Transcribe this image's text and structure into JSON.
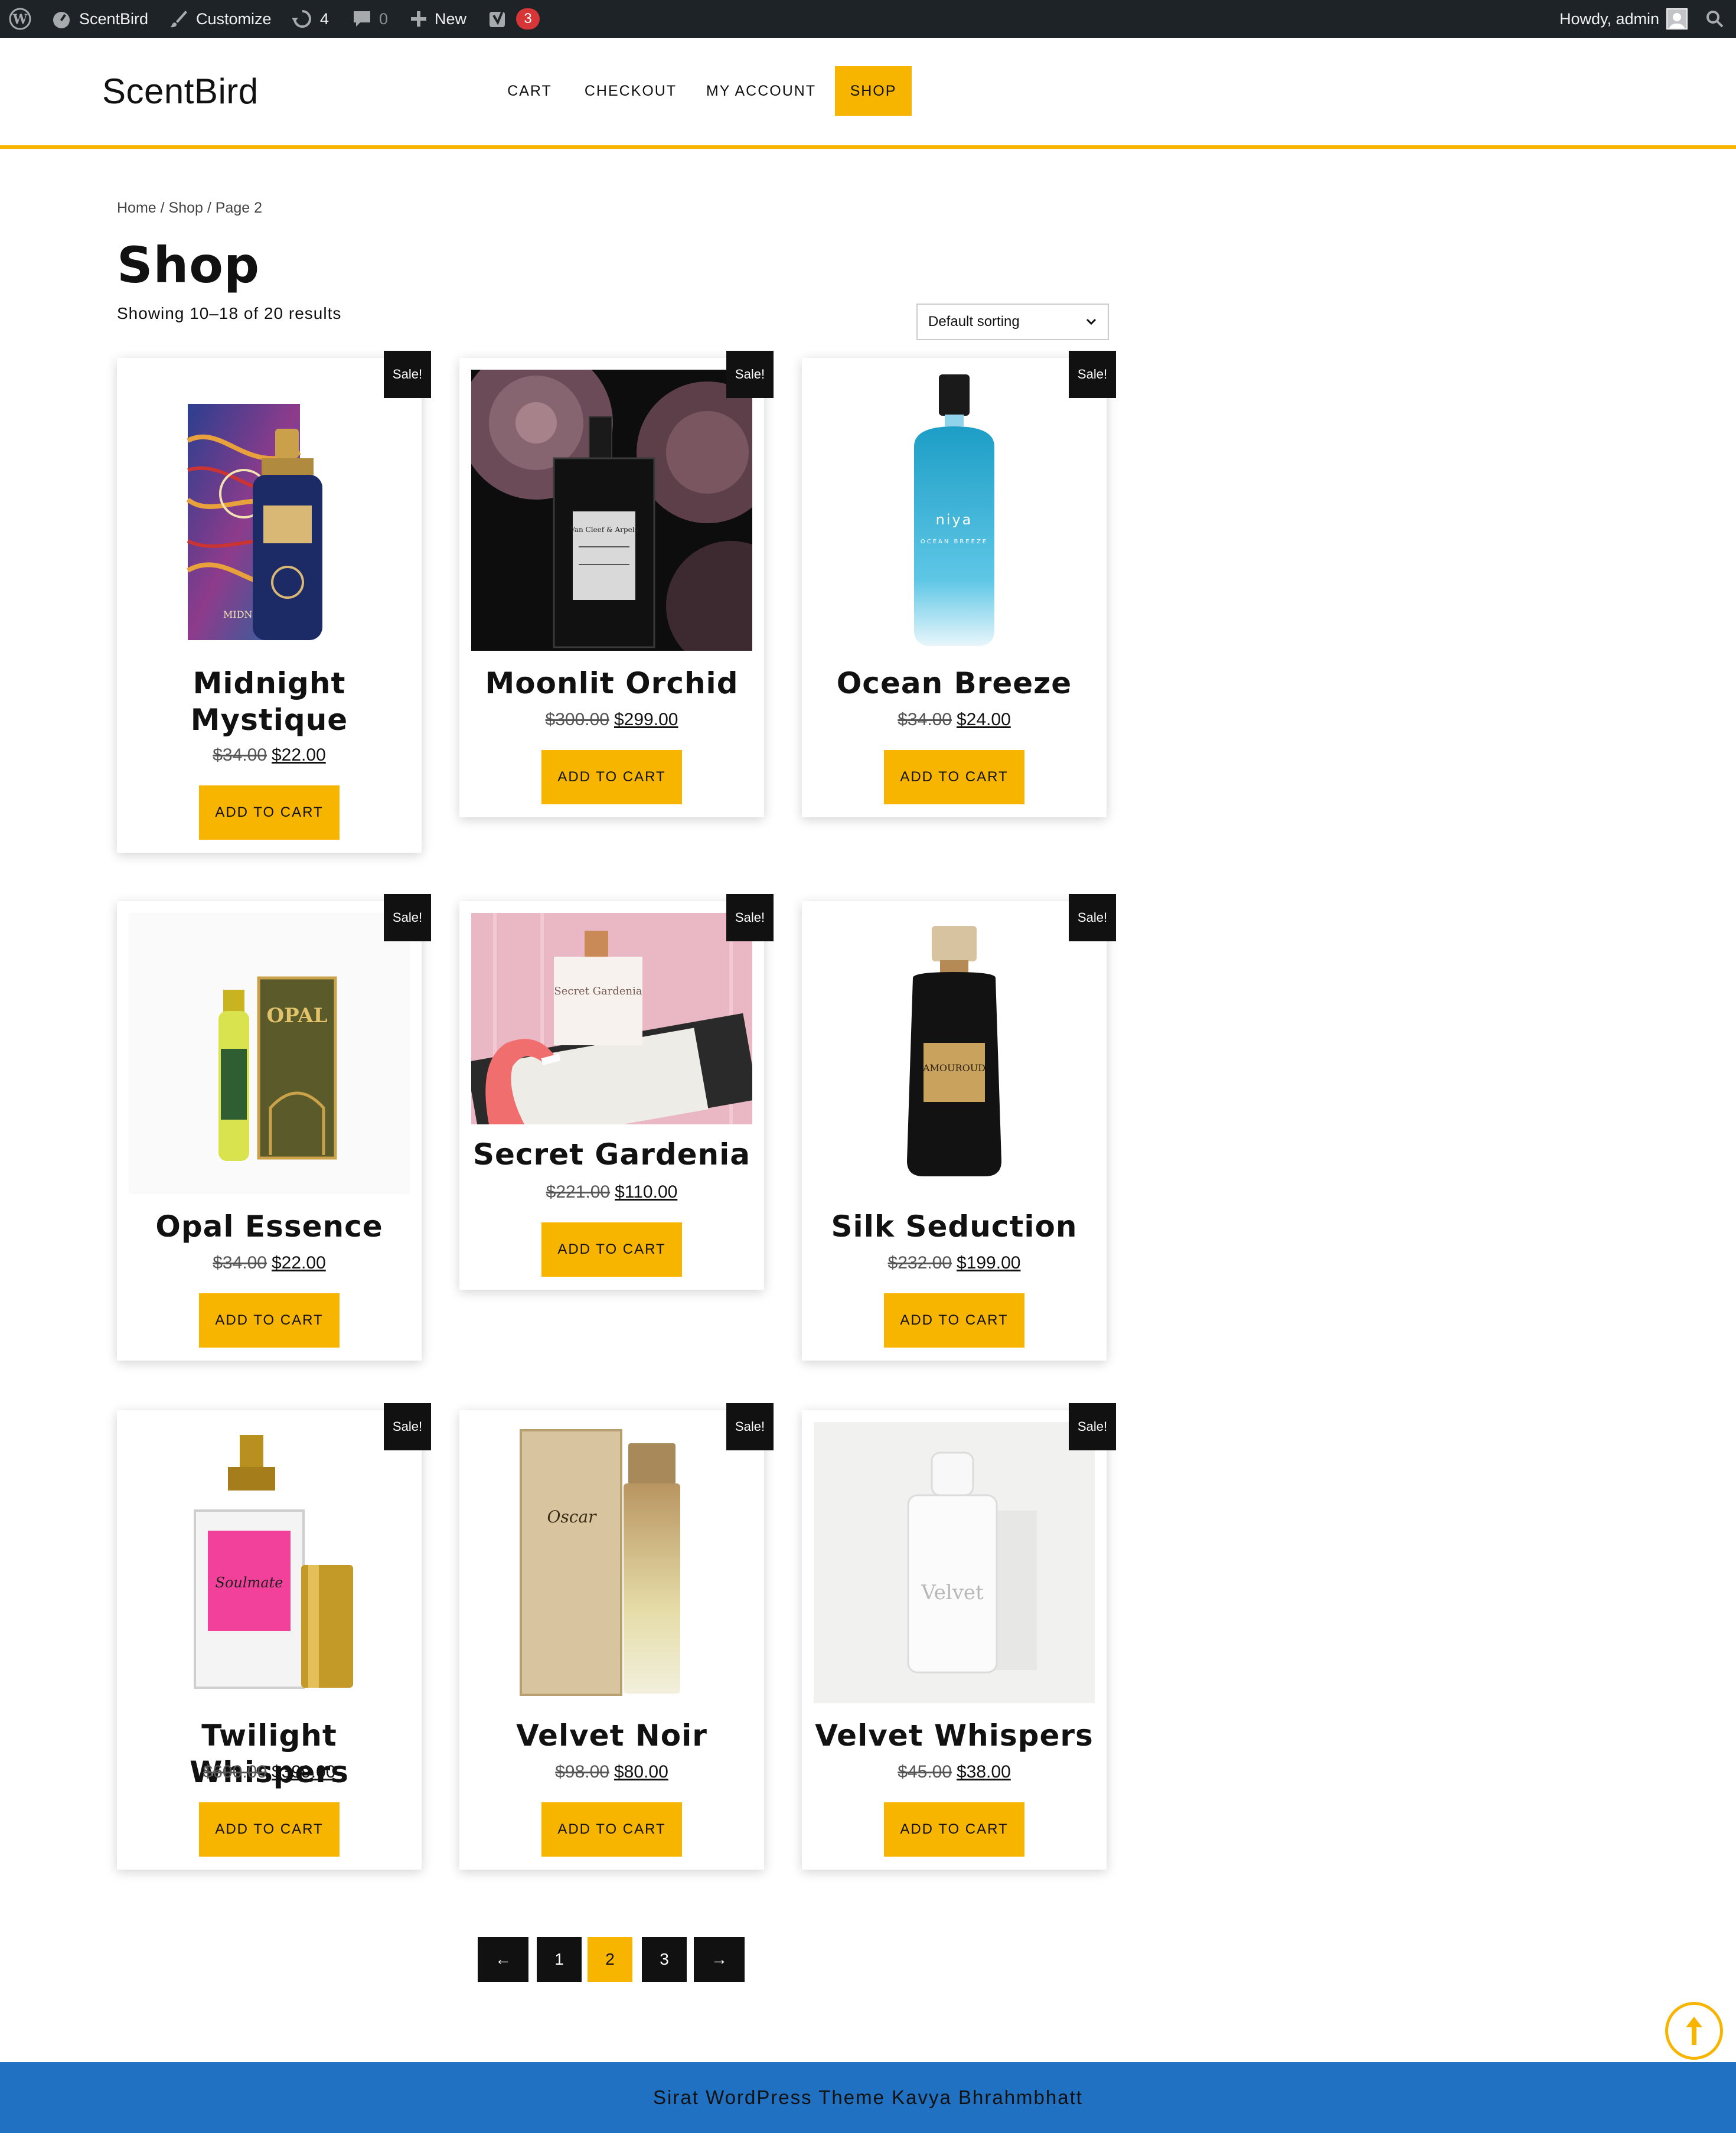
{
  "admin_bar": {
    "site_name": "ScentBird",
    "customize": "Customize",
    "updates_count": "4",
    "comments_count": "0",
    "new_label": "New",
    "yoast_badge": "3",
    "greeting": "Howdy, admin"
  },
  "header": {
    "logo": "ScentBird",
    "nav": [
      "CART",
      "CHECKOUT",
      "MY ACCOUNT",
      "SHOP"
    ],
    "active_nav": "SHOP"
  },
  "breadcrumb": "Home / Shop / Page 2",
  "page_title": "Shop",
  "result_count": "Showing 10–18 of 20 results",
  "sorting": {
    "selected": "Default sorting"
  },
  "sale_badge": "Sale!",
  "add_to_cart_label": "ADD TO CART",
  "products": [
    {
      "name_line1": "Midnight",
      "name_line2": "Mystique",
      "old_price": "$34.00",
      "price": "$22.00",
      "image": "midnight-oud-bottle-and-box"
    },
    {
      "name_line1": "Moonlit Orchid",
      "name_line2": "",
      "old_price": "$300.00",
      "price": "$299.00",
      "image": "black-bottle-with-roses"
    },
    {
      "name_line1": "Ocean Breeze",
      "name_line2": "",
      "old_price": "$34.00",
      "price": "$24.00",
      "image": "blue-niya-bottle"
    },
    {
      "name_line1": "Opal Essence",
      "name_line2": "",
      "old_price": "$34.00",
      "price": "$22.00",
      "image": "opal-oil-box"
    },
    {
      "name_line1": "Secret Gardenia",
      "name_line2": "",
      "old_price": "$221.00",
      "price": "$110.00",
      "image": "pink-flamingo-perfume"
    },
    {
      "name_line1": "Silk Seduction",
      "name_line2": "",
      "old_price": "$232.00",
      "price": "$199.00",
      "image": "black-amouroud-bottle"
    },
    {
      "name_line1": "Twilight Whispers",
      "name_line2": "",
      "old_price": "$600.00",
      "price": "$399.00",
      "image": "pink-label-bottle"
    },
    {
      "name_line1": "Velvet Noir",
      "name_line2": "",
      "old_price": "$98.00",
      "price": "$80.00",
      "image": "oscar-velvet-noir-box"
    },
    {
      "name_line1": "Velvet Whispers",
      "name_line2": "",
      "old_price": "$45.00",
      "price": "$38.00",
      "image": "white-velvet-bottle"
    }
  ],
  "image_text": {
    "p1_box": "MIDNIGHT OUD",
    "p2_label": "Van Cleef & Arpels",
    "p3_label": "niya",
    "p3_sub": "OCEAN BREEZE",
    "p4_box": "OPAL",
    "p5_label": "Secret Gardenia",
    "p6_label": "AMOUROUD",
    "p7_label": "Soulmate",
    "p8_box": "Oscar",
    "p9_label": "Velvet"
  },
  "pagination": {
    "prev": "←",
    "pages": [
      "1",
      "2",
      "3"
    ],
    "current": "2",
    "next": "→"
  },
  "footer": "Sirat WordPress Theme Kavya Bhrahmbhatt",
  "colors": {
    "accent": "#f7b500",
    "admin_bar": "#1d2327",
    "footer": "#2071c1",
    "badge": "#d63638"
  }
}
